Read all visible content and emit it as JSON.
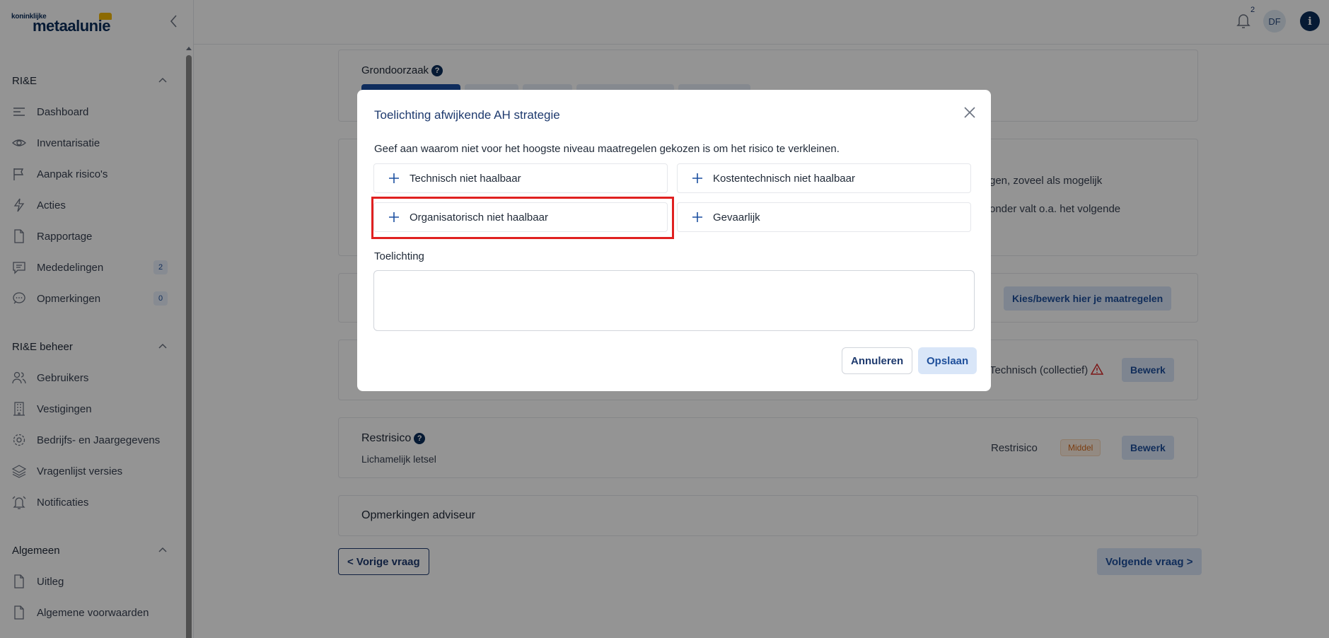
{
  "brand": {
    "logo_small": "koninklijke",
    "logo_big": "metaalunie"
  },
  "sidebar": {
    "sections": [
      {
        "title": "RI&E",
        "items": [
          {
            "label": "Dashboard",
            "icon": "dashboard-lines-icon"
          },
          {
            "label": "Inventarisatie",
            "icon": "eye-icon"
          },
          {
            "label": "Aanpak risico's",
            "icon": "flag-icon"
          },
          {
            "label": "Acties",
            "icon": "lightning-icon"
          },
          {
            "label": "Rapportage",
            "icon": "document-icon"
          },
          {
            "label": "Mededelingen",
            "icon": "message-icon",
            "badge": "2"
          },
          {
            "label": "Opmerkingen",
            "icon": "chat-icon",
            "badge": "0"
          }
        ]
      },
      {
        "title": "RI&E beheer",
        "items": [
          {
            "label": "Gebruikers",
            "icon": "users-icon"
          },
          {
            "label": "Vestigingen",
            "icon": "building-icon"
          },
          {
            "label": "Bedrijfs- en Jaargegevens",
            "icon": "gear-icon"
          },
          {
            "label": "Vragenlijst versies",
            "icon": "layers-icon"
          },
          {
            "label": "Notificaties",
            "icon": "alarm-icon"
          }
        ]
      },
      {
        "title": "Algemeen",
        "items": [
          {
            "label": "Uitleg",
            "icon": "document-icon"
          },
          {
            "label": "Algemene voorwaarden",
            "icon": "document-icon"
          }
        ]
      }
    ]
  },
  "topbar": {
    "notification_count": "2",
    "avatar_initials": "DF",
    "info_label": "i"
  },
  "main": {
    "grondoorzaak_title": "Grondoorzaak",
    "help_label": "?",
    "card2_line1": "gen, zoveel als mogelijk",
    "card2_line2": "onder valt o.a. het volgende",
    "maatregelen_button": "Kies/bewerk hier je maatregelen",
    "technisch_label": "Technisch (collectief)",
    "bewerk_label": "Bewerk",
    "restrisico_title": "Restrisico",
    "restrisico_subtitle": "Lichamelijk letsel",
    "restrisico_label": "Restrisico",
    "restrisico_level": "Middel",
    "opmerkingen_title": "Opmerkingen adviseur",
    "prev_button": "< Vorige vraag",
    "next_button": "Volgende vraag >"
  },
  "modal": {
    "title": "Toelichting afwijkende AH strategie",
    "description": "Geef aan waarom niet voor het hoogste niveau maatregelen gekozen is om het risico te verkleinen.",
    "options": [
      "Technisch niet haalbaar",
      "Kostentechnisch niet haalbaar",
      "Organisatorisch niet haalbaar",
      "Gevaarlijk"
    ],
    "toelichting_label": "Toelichting",
    "toelichting_value": "",
    "cancel_label": "Annuleren",
    "save_label": "Opslaan"
  },
  "colors": {
    "accent": "#1b4fa0",
    "navy": "#0b2d5b",
    "highlight": "#e02020",
    "warning": "#d46a1d"
  }
}
